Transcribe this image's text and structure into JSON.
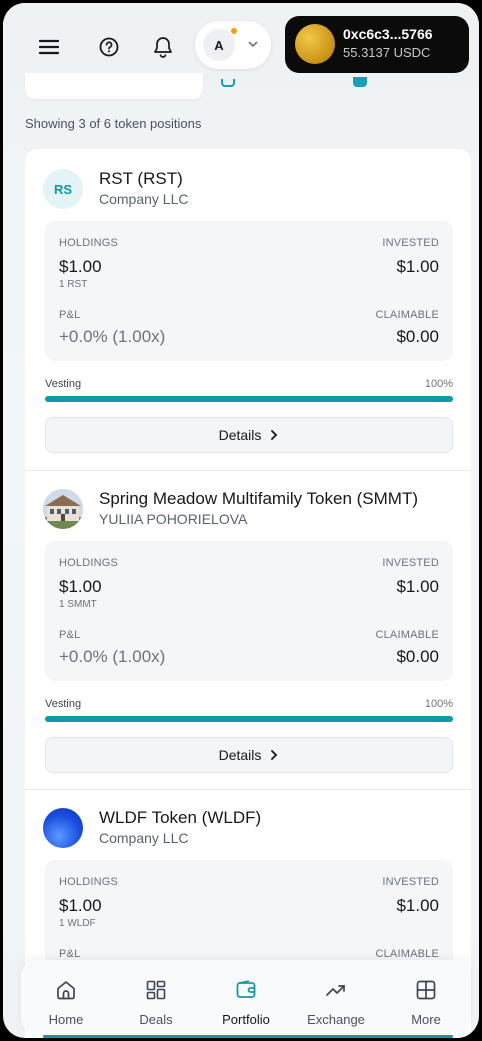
{
  "header": {
    "account_initial": "A",
    "wallet_address": "0xc6c3...5766",
    "wallet_balance": "55.3137 USDC"
  },
  "showing_text": "Showing 3 of 6 token positions",
  "labels": {
    "holdings": "HOLDINGS",
    "invested": "INVESTED",
    "pnl": "P&L",
    "claimable": "CLAIMABLE",
    "vesting": "Vesting",
    "details": "Details"
  },
  "tokens": [
    {
      "avatar_text": "RS",
      "name": "RST (RST)",
      "issuer": "Company LLC",
      "holdings": "$1.00",
      "holdings_units": "1 RST",
      "invested": "$1.00",
      "pnl": "+0.0% (1.00x)",
      "claimable": "$0.00",
      "vesting_pct": "100%",
      "vesting_fraction": 1.0
    },
    {
      "avatar_text": "",
      "name": "Spring Meadow Multifamily Token (SMMT)",
      "issuer": "YULIIA POHORIELOVA",
      "holdings": "$1.00",
      "holdings_units": "1 SMMT",
      "invested": "$1.00",
      "pnl": "+0.0% (1.00x)",
      "claimable": "$0.00",
      "vesting_pct": "100%",
      "vesting_fraction": 1.0
    },
    {
      "avatar_text": "",
      "name": "WLDF Token (WLDF)",
      "issuer": "Company LLC",
      "holdings": "$1.00",
      "holdings_units": "1 WLDF",
      "invested": "$1.00"
    }
  ],
  "nav": [
    {
      "label": "Home",
      "icon": "home-icon",
      "active": false
    },
    {
      "label": "Deals",
      "icon": "grid-icon",
      "active": false
    },
    {
      "label": "Portfolio",
      "icon": "wallet-icon",
      "active": true
    },
    {
      "label": "Exchange",
      "icon": "trend-icon",
      "active": false
    },
    {
      "label": "More",
      "icon": "squares-icon",
      "active": false
    }
  ],
  "colors": {
    "accent": "#1499a8",
    "wallet_bg": "#0b0b0c",
    "notification_dot": "#f59e0b"
  }
}
